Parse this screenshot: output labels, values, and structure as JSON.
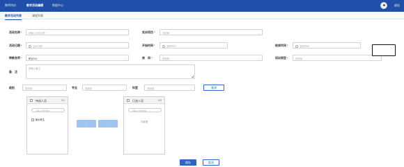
{
  "topbar": {
    "nav": [
      "教师特训",
      "教学活动编辑",
      "数据中心"
    ],
    "exit": "退出"
  },
  "subtabs": [
    "教学活动列表",
    "课程列表"
  ],
  "form": {
    "activity_name": {
      "label": "活动名称",
      "placeholder": "请输入活动名称"
    },
    "project": {
      "label": "实训项目",
      "placeholder": "请选择"
    },
    "date": {
      "label": "活动日期",
      "placeholder": "活动日期"
    },
    "start_time": {
      "label": "开始时间",
      "placeholder": "选择时间"
    },
    "end_time": {
      "label": "结束时间",
      "placeholder": "选择时间"
    },
    "teacher": {
      "label": "带教老师",
      "value": "教官001"
    },
    "room": {
      "label": "房　间",
      "placeholder": "请选择"
    },
    "training_type": {
      "label": "培训类型",
      "placeholder": "请选择"
    },
    "remark": {
      "label": "备　注",
      "placeholder": "请输入备注"
    }
  },
  "filters": {
    "grade": {
      "label": "级别",
      "placeholder": "请选择"
    },
    "major": {
      "label": "专业",
      "placeholder": "请选择"
    },
    "subject": {
      "label": "科室",
      "placeholder": "请选择"
    },
    "query_label": "查询"
  },
  "transfer": {
    "left": {
      "title": "待选人员",
      "count": "0/1",
      "search_placeholder": "请输入搜索内容",
      "items": [
        "演示考生"
      ]
    },
    "right": {
      "title": "已选人员",
      "count": "0/0",
      "search_placeholder": "请输入搜索内容",
      "empty": "无数据"
    },
    "to_left": "‹",
    "to_right": "›"
  },
  "actions": {
    "save": "保存",
    "cancel": "取消"
  }
}
